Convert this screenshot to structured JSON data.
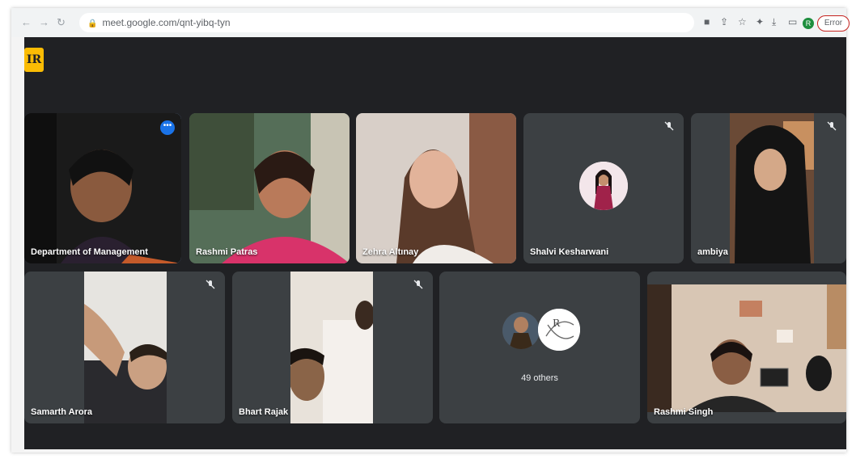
{
  "browser": {
    "url": "meet.google.com/qnt-yibq-tyn",
    "avatar_letter": "R",
    "error_label": "Error"
  },
  "meet": {
    "tiles": [
      {
        "name": "Department of Management",
        "active": true
      },
      {
        "name": "Rashmi Patras"
      },
      {
        "name": "Zehra Altınay"
      },
      {
        "name": "Shalvi Kesharwani",
        "muted": true
      },
      {
        "name": "ambiya",
        "muted": true
      },
      {
        "name": "Samarth Arora",
        "muted": true
      },
      {
        "name": "Bhart Rajak",
        "muted": true
      },
      {
        "name": "49 others"
      },
      {
        "name": "Rashmi Singh"
      }
    ]
  },
  "colors": {
    "meet_background": "#202124",
    "tile_background": "#3c4043",
    "active_border": "#8ab4f8",
    "more_button": "#1a73e8",
    "logo": "#fbbc04"
  }
}
